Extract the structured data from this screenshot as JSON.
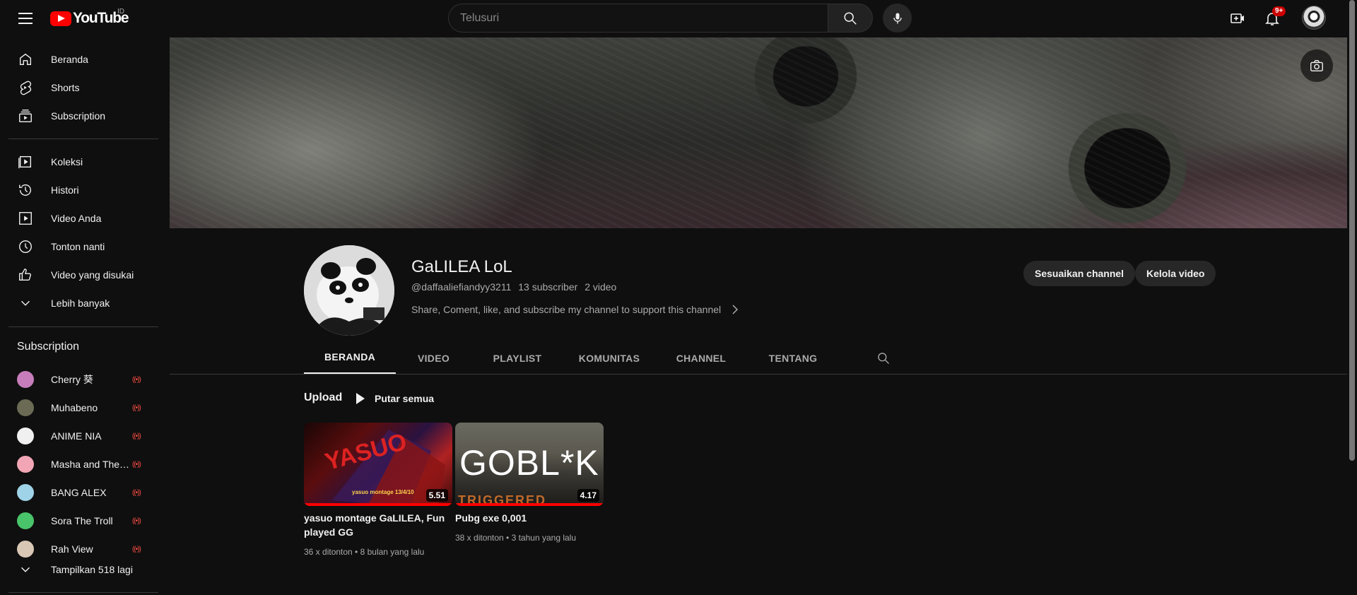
{
  "header": {
    "logo_text": "YouTube",
    "country_code": "ID",
    "search_placeholder": "Telusuri",
    "notification_count": "9+",
    "icons": [
      "menu-icon",
      "search-icon",
      "mic-icon",
      "create-video-icon",
      "bell-icon",
      "avatar"
    ]
  },
  "sidebar": {
    "main": [
      {
        "label": "Beranda",
        "icon": "home-icon"
      },
      {
        "label": "Shorts",
        "icon": "shorts-icon"
      },
      {
        "label": "Subscription",
        "icon": "subscriptions-icon"
      }
    ],
    "library": [
      {
        "label": "Koleksi",
        "icon": "library-icon"
      },
      {
        "label": "Histori",
        "icon": "history-icon"
      },
      {
        "label": "Video Anda",
        "icon": "your-videos-icon"
      },
      {
        "label": "Tonton nanti",
        "icon": "watch-later-icon"
      },
      {
        "label": "Video yang disukai",
        "icon": "like-icon"
      },
      {
        "label": "Lebih banyak",
        "icon": "chevron-down-icon"
      }
    ],
    "subscriptions_heading": "Subscription",
    "subscriptions": [
      {
        "name": "Cherry 葵",
        "color": "#c77dbb"
      },
      {
        "name": "Muhabeno",
        "color": "#6b6b55"
      },
      {
        "name": "ANIME NIA",
        "color": "#f0f0f0"
      },
      {
        "name": "Masha and The Bear",
        "color": "#f2a6b5"
      },
      {
        "name": "BANG ALEX",
        "color": "#9fd3e8"
      },
      {
        "name": "Sora The Troll",
        "color": "#49c46a"
      },
      {
        "name": "Rah View",
        "color": "#d9c7b5"
      }
    ],
    "show_more": "Tampilkan 518 lagi"
  },
  "channel": {
    "name": "GaLILEA LoL",
    "handle": "@daffaaliefiandyy3211",
    "subscribers": "13 subscriber",
    "videos": "2 video",
    "description": "Share, Coment, like, and subscribe my channel to support this channel",
    "buttons": {
      "customize": "Sesuaikan channel",
      "manage": "Kelola video"
    }
  },
  "tabs": [
    "BERANDA",
    "VIDEO",
    "PLAYLIST",
    "KOMUNITAS",
    "CHANNEL",
    "TENTANG"
  ],
  "active_tab": "BERANDA",
  "section": {
    "title": "Upload",
    "play_all": "Putar semua"
  },
  "videos": [
    {
      "title": "yasuo montage GaLILEA, Fun played GG",
      "views": "36 x ditonton",
      "age": "8 bulan yang lalu",
      "duration": "5.51",
      "thumb_text": "yasuo montage 13/4/10",
      "watched_fraction": 1.0
    },
    {
      "title": "Pubg exe 0,001",
      "views": "38 x ditonton",
      "age": "3 tahun yang lalu",
      "duration": "4.17",
      "thumb_text": "GOBL*K",
      "thumb_sub": "TRIGGERED",
      "watched_fraction": 1.0
    }
  ],
  "colors": {
    "background": "#0f0f0f",
    "brand_red": "#ff0000",
    "text": "#f1f1f1",
    "muted": "#aaaaaa"
  }
}
